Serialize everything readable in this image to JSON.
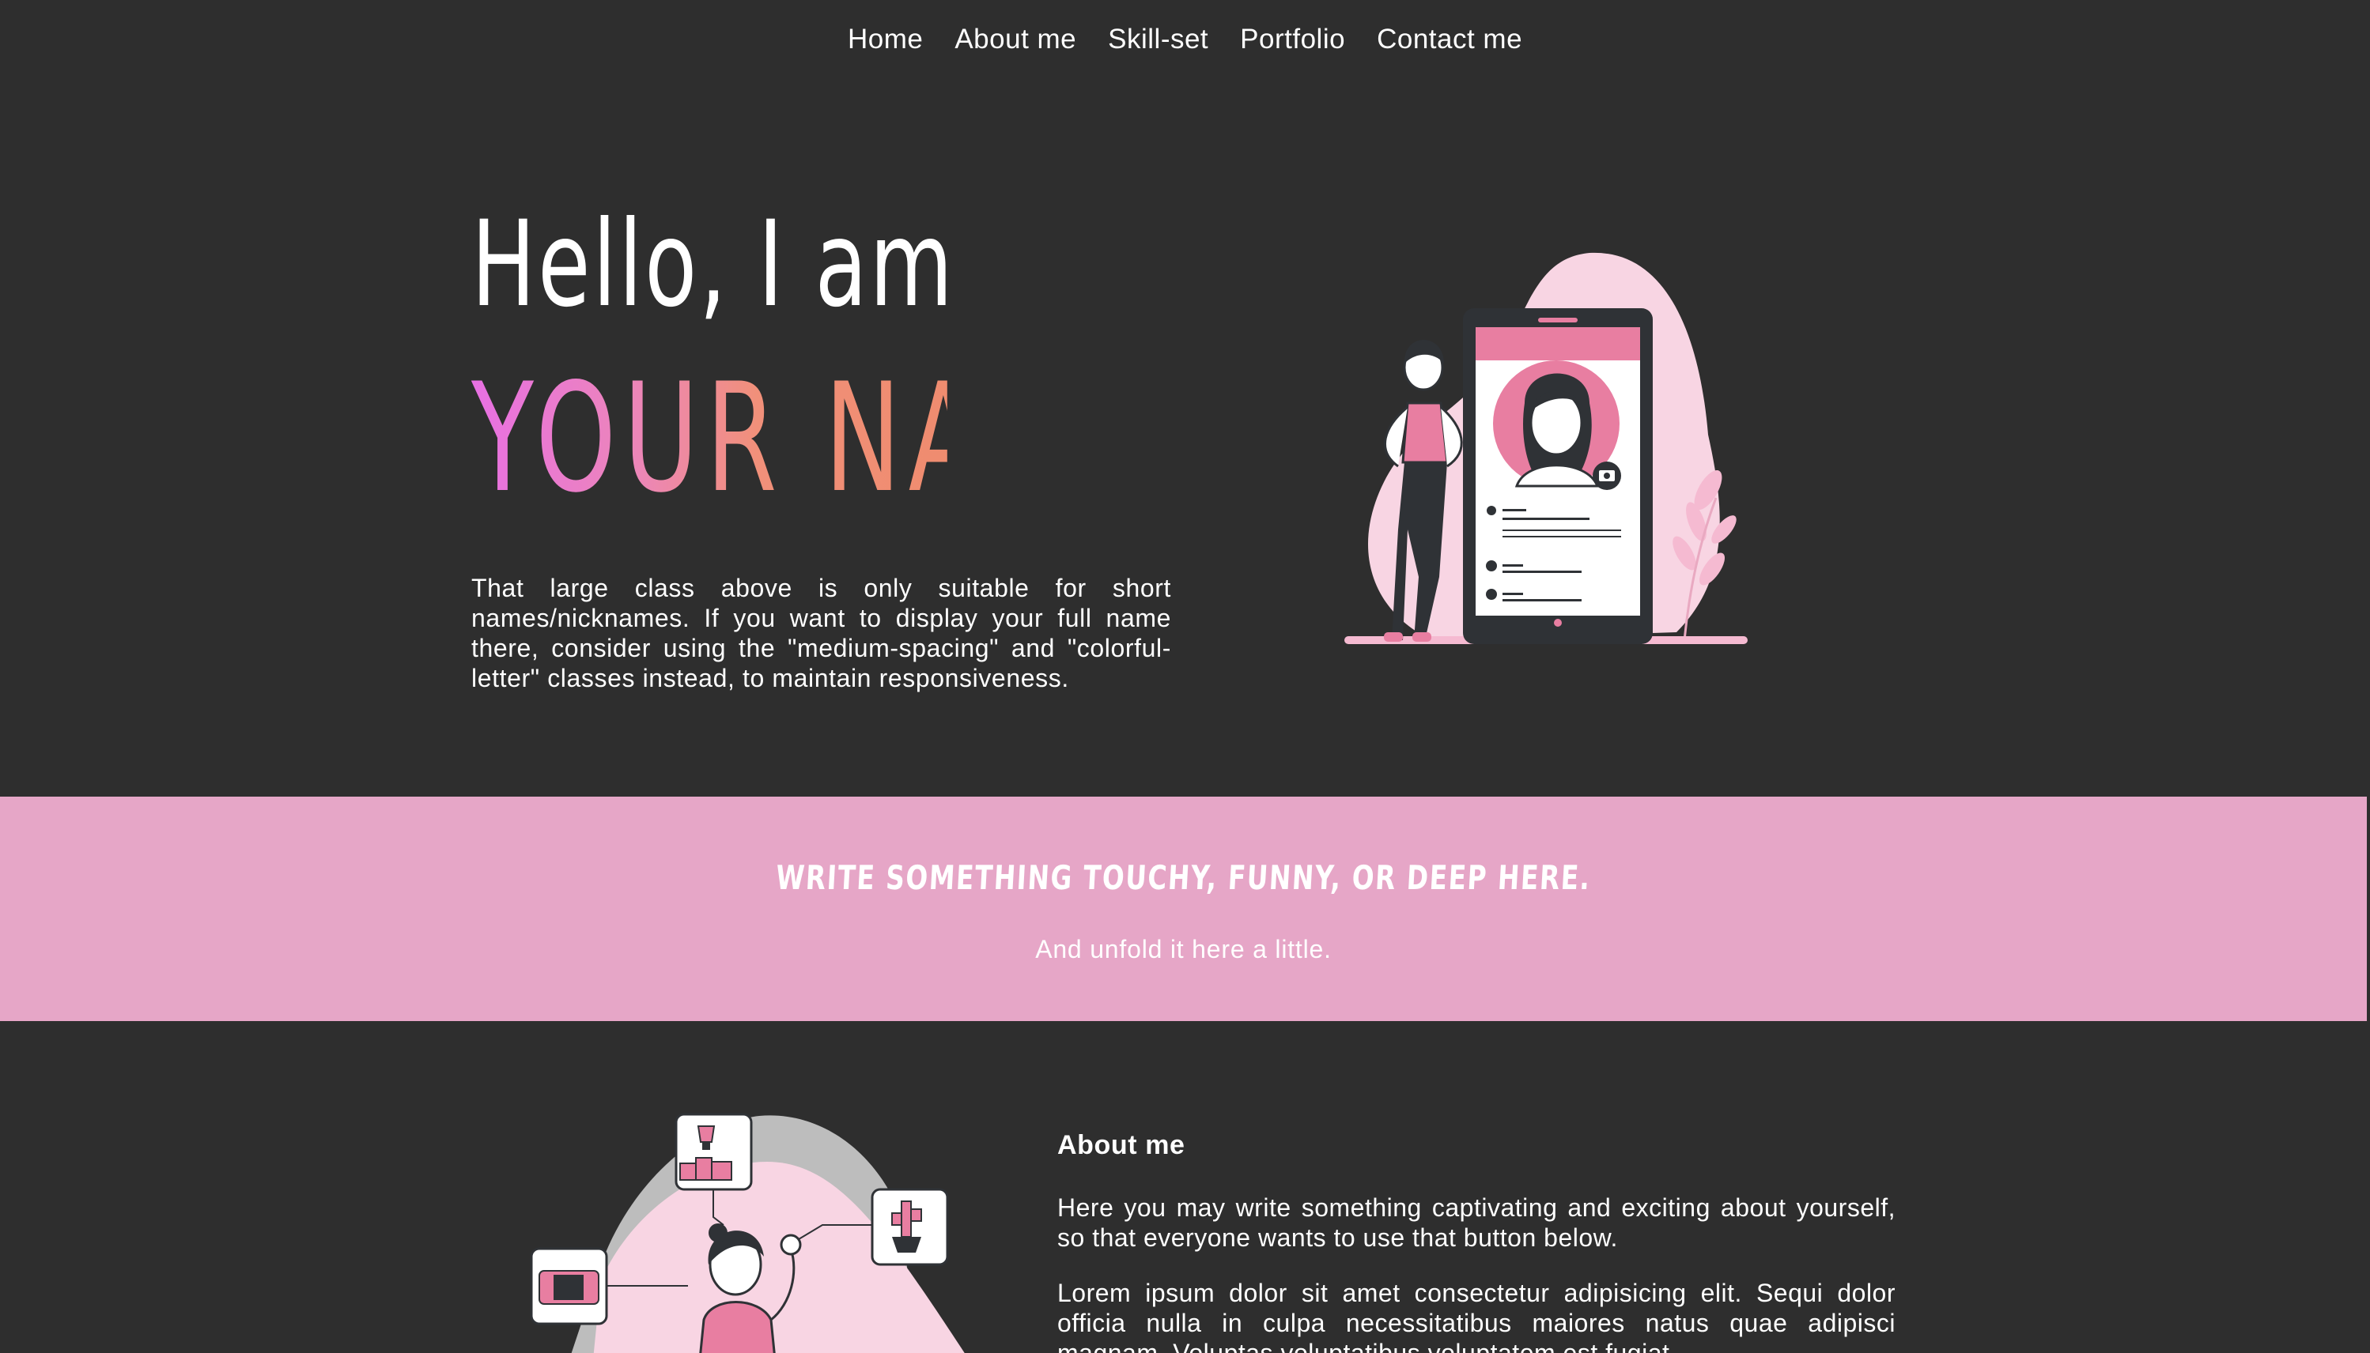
{
  "nav": {
    "items": [
      "Home",
      "About me",
      "Skill-set",
      "Portfolio",
      "Contact me"
    ]
  },
  "hero": {
    "greeting": "Hello, I am",
    "name": "YOUR NAME",
    "text": "That large class above is only suitable for short names/nicknames. If you want to display your full name there, consider using the \"medium-spacing\" and \"colorful-letter\" classes instead, to maintain responsiveness."
  },
  "banner": {
    "title": "Write something touchy, funny, or deep here.",
    "subtitle": "And unfold it here a little."
  },
  "about": {
    "heading": "About me",
    "paragraph1": "Here you may write something captivating and exciting about yourself, so that everyone wants to use that button below.",
    "paragraph2": "Lorem ipsum dolor sit amet consectetur adipisicing elit. Sequi dolor officia nulla in culpa necessitatibus maiores natus quae adipisci magnam. Voluptas voluptatibus voluptatem est fugiat."
  },
  "colors": {
    "background": "#2e2e2e",
    "banner": "#e6a6c7",
    "accent_pink": "#e87ea1",
    "gradient_start": "#e870e3",
    "gradient_end": "#ef8c6f"
  },
  "icons": [
    "profile-phone-illustration",
    "achievements-illustration"
  ]
}
